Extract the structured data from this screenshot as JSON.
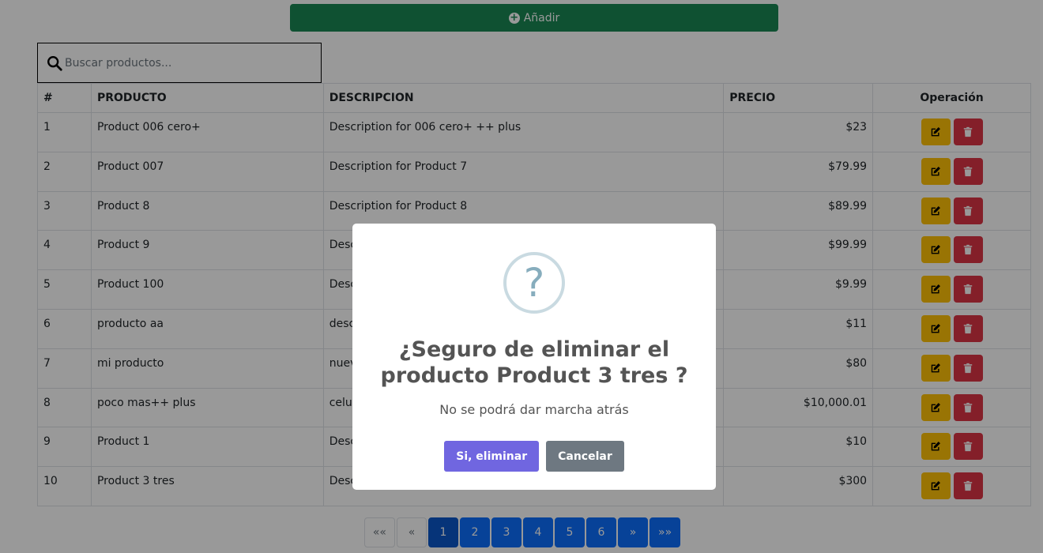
{
  "toolbar": {
    "add_label": "Añadir"
  },
  "search": {
    "placeholder": "Buscar productos..."
  },
  "table": {
    "headers": [
      "#",
      "PRODUCTO",
      "DESCRIPCION",
      "PRECIO",
      "Operación"
    ],
    "rows": [
      {
        "id": "1",
        "product": "Product 006 cero+",
        "description": "Description for 006 cero+ ++ plus",
        "price": "$23"
      },
      {
        "id": "2",
        "product": "Product 007",
        "description": "Description for Product 7",
        "price": "$79.99"
      },
      {
        "id": "3",
        "product": "Product 8",
        "description": "Description for Product 8",
        "price": "$89.99"
      },
      {
        "id": "4",
        "product": "Product 9",
        "description": "Desc",
        "price": "$99.99"
      },
      {
        "id": "5",
        "product": "Product 100",
        "description": "Desc",
        "price": "$9.99"
      },
      {
        "id": "6",
        "product": "producto aa",
        "description": "desc",
        "price": "$11"
      },
      {
        "id": "7",
        "product": "mi producto",
        "description": "nuev",
        "price": "$80"
      },
      {
        "id": "8",
        "product": "poco mas++ plus",
        "description": "celu",
        "price": "$10,000.01"
      },
      {
        "id": "9",
        "product": "Product 1",
        "description": "Desc",
        "price": "$10"
      },
      {
        "id": "10",
        "product": "Product 3 tres",
        "description": "Desc",
        "price": "$300"
      }
    ]
  },
  "pagination": {
    "first": "««",
    "prev": "«",
    "pages": [
      "1",
      "2",
      "3",
      "4",
      "5",
      "6"
    ],
    "next": "»",
    "last": "»»",
    "current": "1"
  },
  "dialog": {
    "icon": "?",
    "title": "¿Seguro de eliminar el producto Product 3 tres ?",
    "text": "No se podrá dar marcha atrás",
    "confirm_label": "Si, eliminar",
    "cancel_label": "Cancelar"
  },
  "colors": {
    "add": "#198754",
    "edit": "#ffc107",
    "delete": "#dc3545",
    "page": "#0d6efd",
    "confirm": "#7066e0",
    "cancel": "#6e7881"
  },
  "icons": {
    "add": "plus-circle-icon",
    "search": "search-icon",
    "edit": "edit-icon",
    "delete": "trash-icon",
    "dialog": "question-icon"
  }
}
